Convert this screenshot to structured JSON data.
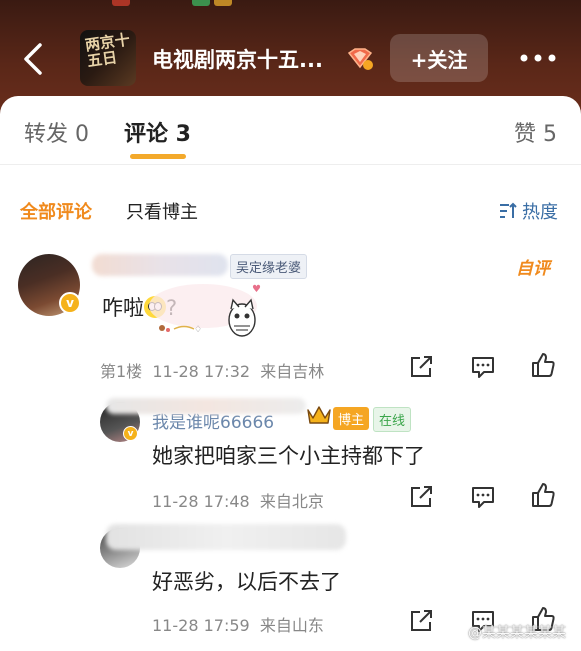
{
  "header": {
    "channel_title": "电视剧两京十五...",
    "follow_label": "+关注",
    "avatar_text": "两京十五日"
  },
  "tabs": [
    {
      "label": "转发 0"
    },
    {
      "label": "评论 3"
    },
    {
      "label": "赞 5"
    }
  ],
  "filters": {
    "all_label": "全部评论",
    "blogger_only_label": "只看博主",
    "sort_label": "热度"
  },
  "comments": [
    {
      "fan_tag": "吴定缘老婆",
      "pick_label": "自评",
      "text": "咋啦",
      "text_suffix": "?",
      "floor": "第1楼",
      "time": "11-28 17:32",
      "location": "来自吉林"
    }
  ],
  "replies": [
    {
      "name_fragment": "我是谁呢66666",
      "blogger_tag": "博主",
      "online_tag": "在线",
      "text": "她家把咱家三个小主持都下了",
      "time": "11-28 17:48",
      "location": "来自北京"
    },
    {
      "text": "好恶劣，以后不去了",
      "time": "11-28 17:59",
      "location": "来自山东"
    }
  ],
  "watermark": "@某某某某某某",
  "colors": {
    "accent_orange": "#f08a1d",
    "tab_underline": "#f3a92b",
    "header_bg": "#5a2718",
    "link_blue": "#3a6ea5"
  },
  "icons": [
    "back-icon",
    "vip-badge-icon",
    "more-icon",
    "sort-icon",
    "share-icon",
    "comment-icon",
    "like-icon",
    "crown-icon",
    "weibo-icon"
  ]
}
